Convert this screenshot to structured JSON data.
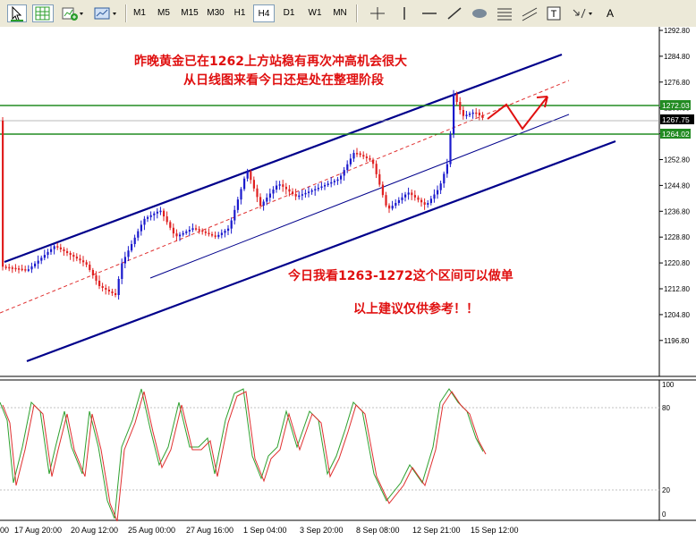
{
  "toolbar": {
    "timeframes": [
      "M1",
      "M5",
      "M15",
      "M30",
      "H1",
      "H4",
      "D1",
      "W1",
      "MN"
    ],
    "active_timeframe": "H4",
    "text_tool": "A",
    "label_tool": "T"
  },
  "chart": {
    "annotations": {
      "line1": "昨晚黄金已在1262上方站稳有再次冲高机会很大",
      "line2": "从日线图来看今日还是处在整理阶段",
      "line3": "今日我看1263-1272这个区间可以做单",
      "line4": "以上建议仅供参考！！"
    },
    "price_axis": [
      "1292.80",
      "1284.80",
      "1276.80",
      "1268.80",
      "1260.80",
      "1252.80",
      "1244.80",
      "1236.80",
      "1228.80",
      "1220.80",
      "1212.80",
      "1204.80",
      "1196.80"
    ],
    "price_tags": {
      "upper": "1272.03",
      "current": "1267.75",
      "lower": "1264.02"
    },
    "stoch_axis": [
      "100",
      "80",
      "20",
      "0"
    ],
    "time_axis": [
      "17 Aug 20:00",
      "20 Aug 12:00",
      "25 Aug 00:00",
      "27 Aug 16:00",
      "1 Sep 04:00",
      "3 Sep 20:00",
      "8 Sep 08:00",
      "12 Sep 21:00",
      "15 Sep 12:00"
    ],
    "time_axis_first": "00",
    "colors": {
      "bull": "#1a1acd",
      "bear": "#e02020",
      "channel": "#00008b",
      "support": "#228b22",
      "annotation": "#e01010"
    }
  }
}
